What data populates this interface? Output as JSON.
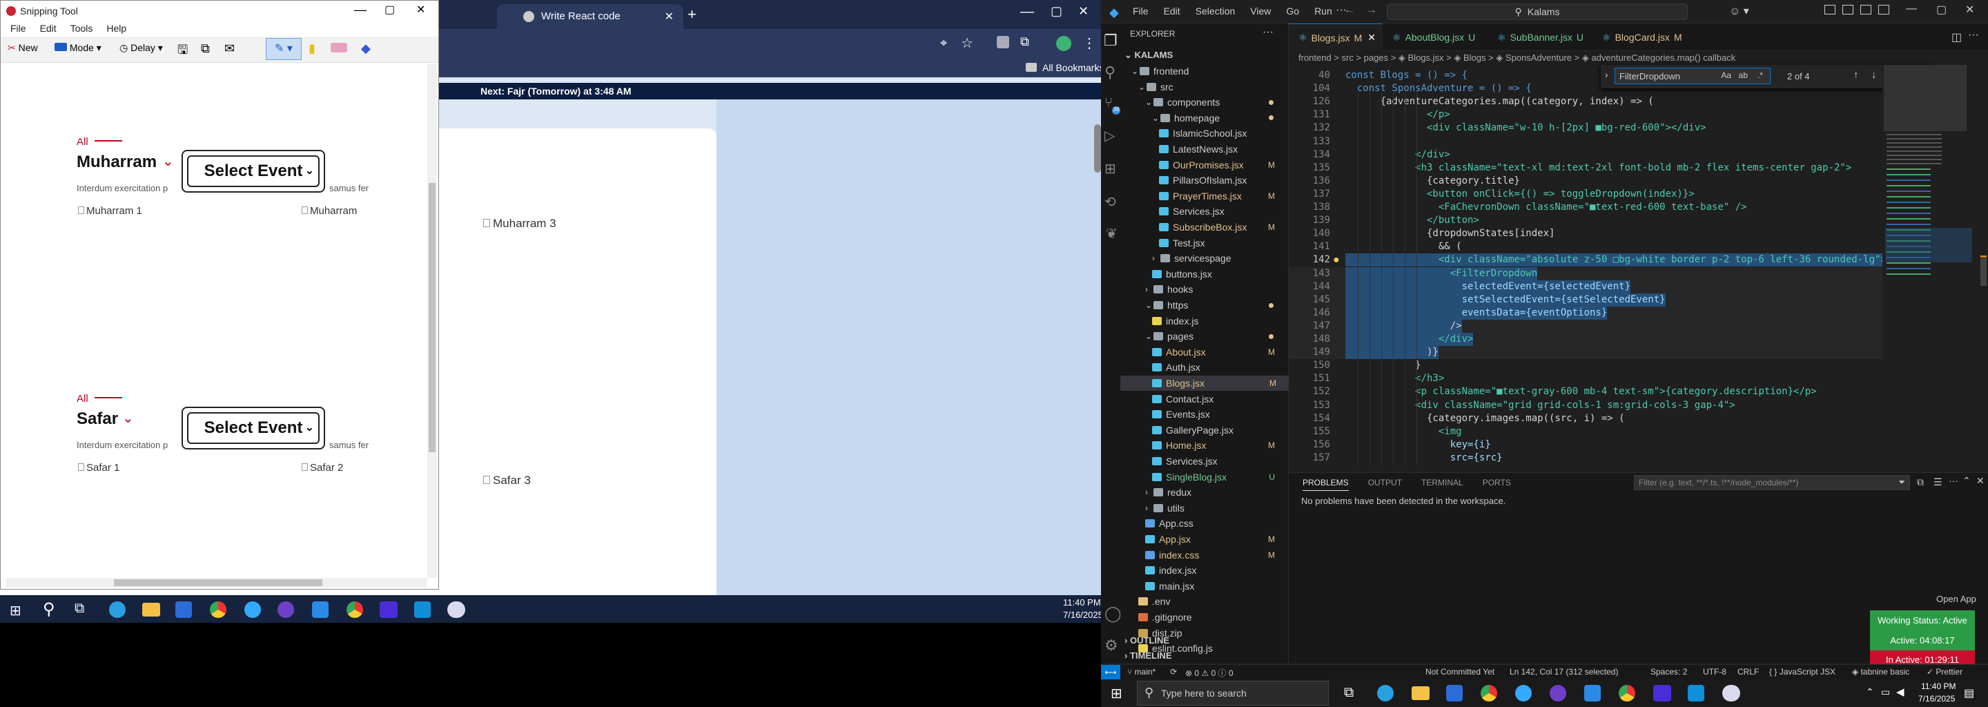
{
  "snip": {
    "title": "Snipping Tool",
    "menu": [
      "File",
      "Edit",
      "Tools",
      "Help"
    ],
    "new_label": "New",
    "mode_label": "Mode",
    "delay_label": "Delay",
    "banner": "Next: Fajr (Tomorrow) at 3:48 AM",
    "sections": [
      {
        "tag": "All",
        "heading": "Muharram",
        "dropdown": "Select Event",
        "intro": "Interdum exercitation p",
        "intro2": "samus fer",
        "img1": "Muharram 1",
        "img2": "Muharram",
        "img3": "Muharram 3"
      },
      {
        "tag": "All",
        "heading": "Safar",
        "dropdown": "Select Event",
        "intro": "Interdum exercitation p",
        "intro2": "samus fer",
        "img1": "Safar 1",
        "img2": "Safar 2",
        "img3": "Safar 3"
      }
    ]
  },
  "chrome": {
    "tab_title": "Write React code",
    "bookmarks": "All Bookmarks"
  },
  "taskbar_left": {
    "time": "11:40 PM",
    "date": "7/16/2025"
  },
  "vscode": {
    "menu": [
      "File",
      "Edit",
      "Selection",
      "View",
      "Go",
      "Run"
    ],
    "search": "Kalams",
    "explorer_title": "EXPLORER",
    "root": "KALAMS",
    "tree": [
      {
        "label": "frontend",
        "depth": 1,
        "kind": "folder",
        "open": true,
        "badge": ""
      },
      {
        "label": "src",
        "depth": 2,
        "kind": "folder",
        "open": true,
        "badge": ""
      },
      {
        "label": "components",
        "depth": 3,
        "kind": "folder",
        "open": true,
        "badge": ""
      },
      {
        "label": "homepage",
        "depth": 4,
        "kind": "folder",
        "open": true,
        "badge": ""
      },
      {
        "label": "IslamicSchool.jsx",
        "depth": 5,
        "kind": "jsx",
        "badge": ""
      },
      {
        "label": "LatestNews.jsx",
        "depth": 5,
        "kind": "jsx",
        "badge": ""
      },
      {
        "label": "OurPromises.jsx",
        "depth": 5,
        "kind": "jsx",
        "badge": "M",
        "mod": true
      },
      {
        "label": "PillarsOfIslam.jsx",
        "depth": 5,
        "kind": "jsx",
        "badge": ""
      },
      {
        "label": "PrayerTimes.jsx",
        "depth": 5,
        "kind": "jsx",
        "badge": "M",
        "mod": true
      },
      {
        "label": "Services.jsx",
        "depth": 5,
        "kind": "jsx",
        "badge": ""
      },
      {
        "label": "SubscribeBox.jsx",
        "depth": 5,
        "kind": "jsx",
        "badge": "M",
        "mod": true
      },
      {
        "label": "Test.jsx",
        "depth": 5,
        "kind": "jsx",
        "badge": ""
      },
      {
        "label": "servicespage",
        "depth": 4,
        "kind": "folder",
        "open": false,
        "badge": ""
      },
      {
        "label": "buttons.jsx",
        "depth": 4,
        "kind": "jsx",
        "badge": ""
      },
      {
        "label": "hooks",
        "depth": 3,
        "kind": "folder",
        "open": false,
        "badge": ""
      },
      {
        "label": "https",
        "depth": 3,
        "kind": "folder",
        "open": true,
        "badge": ""
      },
      {
        "label": "index.js",
        "depth": 4,
        "kind": "js",
        "badge": ""
      },
      {
        "label": "pages",
        "depth": 3,
        "kind": "folder",
        "open": true,
        "badge": ""
      },
      {
        "label": "About.jsx",
        "depth": 4,
        "kind": "jsx",
        "badge": "M",
        "mod": true
      },
      {
        "label": "Auth.jsx",
        "depth": 4,
        "kind": "jsx",
        "badge": ""
      },
      {
        "label": "Blogs.jsx",
        "depth": 4,
        "kind": "jsx",
        "badge": "M",
        "mod": true,
        "active": true
      },
      {
        "label": "Contact.jsx",
        "depth": 4,
        "kind": "jsx",
        "badge": ""
      },
      {
        "label": "Events.jsx",
        "depth": 4,
        "kind": "jsx",
        "badge": ""
      },
      {
        "label": "GalleryPage.jsx",
        "depth": 4,
        "kind": "jsx",
        "badge": ""
      },
      {
        "label": "Home.jsx",
        "depth": 4,
        "kind": "jsx",
        "badge": "M",
        "mod": true
      },
      {
        "label": "Services.jsx",
        "depth": 4,
        "kind": "jsx",
        "badge": ""
      },
      {
        "label": "SingleBlog.jsx",
        "depth": 4,
        "kind": "jsx",
        "badge": "U",
        "untr": true
      },
      {
        "label": "redux",
        "depth": 3,
        "kind": "folder",
        "open": false,
        "badge": ""
      },
      {
        "label": "utils",
        "depth": 3,
        "kind": "folder",
        "open": false,
        "badge": ""
      },
      {
        "label": "App.css",
        "depth": 3,
        "kind": "css",
        "badge": ""
      },
      {
        "label": "App.jsx",
        "depth": 3,
        "kind": "jsx",
        "badge": "M",
        "mod": true
      },
      {
        "label": "index.css",
        "depth": 3,
        "kind": "css",
        "badge": "M",
        "mod": true
      },
      {
        "label": "index.jsx",
        "depth": 3,
        "kind": "jsx",
        "badge": ""
      },
      {
        "label": "main.jsx",
        "depth": 3,
        "kind": "jsx",
        "badge": ""
      },
      {
        "label": ".env",
        "depth": 2,
        "kind": "env",
        "badge": ""
      },
      {
        "label": ".gitignore",
        "depth": 2,
        "kind": "git",
        "badge": ""
      },
      {
        "label": "dist.zip",
        "depth": 2,
        "kind": "zip",
        "badge": ""
      },
      {
        "label": "eslint.config.js",
        "depth": 2,
        "kind": "js",
        "badge": ""
      }
    ],
    "outline": "OUTLINE",
    "timeline": "TIMELINE",
    "tabs": [
      {
        "label": "Blogs.jsx",
        "flag": "M",
        "active": true
      },
      {
        "label": "AboutBlog.jsx",
        "flag": "U"
      },
      {
        "label": "SubBanner.jsx",
        "flag": "U"
      },
      {
        "label": "BlogCard.jsx",
        "flag": "M"
      }
    ],
    "breadcrumb": "frontend > src > pages > ◈ Blogs.jsx > ◈ Blogs > ◈ SponsAdventure > ◈ adventureCategories.map() callback",
    "find": {
      "value": "FilterDropdown",
      "count": "2 of 4"
    },
    "code": [
      {
        "n": "40",
        "t": "const Blogs = () => {"
      },
      {
        "n": "104",
        "t": "  const SponsAdventure = () => {"
      },
      {
        "n": "126",
        "t": "      {adventureCategories.map((category, index) => ("
      },
      {
        "n": "131",
        "t": "              </p>"
      },
      {
        "n": "132",
        "t": "              <div className=\"w-10 h-[2px] ■bg-red-600\"></div>"
      },
      {
        "n": "133",
        "t": ""
      },
      {
        "n": "134",
        "t": "            </div>"
      },
      {
        "n": "135",
        "t": "            <h3 className=\"text-xl md:text-2xl font-bold mb-2 flex items-center gap-2\">"
      },
      {
        "n": "136",
        "t": "              {category.title}"
      },
      {
        "n": "137",
        "t": "              <button onClick={() => toggleDropdown(index)}>"
      },
      {
        "n": "138",
        "t": "                <FaChevronDown className=\"■text-red-600 text-base\" />"
      },
      {
        "n": "139",
        "t": "              </button>"
      },
      {
        "n": "140",
        "t": "              {dropdownStates[index]"
      },
      {
        "n": "141",
        "t": "                && ("
      },
      {
        "n": "142",
        "t": "                <div className=\"absolute z-50 □bg-white border p-2 top-6 left-36 rounded-lg\">"
      },
      {
        "n": "143",
        "t": "                  <FilterDropdown"
      },
      {
        "n": "144",
        "t": "                    selectedEvent={selectedEvent}"
      },
      {
        "n": "145",
        "t": "                    setSelectedEvent={setSelectedEvent}"
      },
      {
        "n": "146",
        "t": "                    eventsData={eventOptions}"
      },
      {
        "n": "147",
        "t": "                  />"
      },
      {
        "n": "148",
        "t": "                </div>"
      },
      {
        "n": "149",
        "t": "              )}"
      },
      {
        "n": "150",
        "t": "            }"
      },
      {
        "n": "151",
        "t": "            </h3>"
      },
      {
        "n": "152",
        "t": "            <p className=\"■text-gray-600 mb-4 text-sm\">{category.description}</p>"
      },
      {
        "n": "153",
        "t": "            <div className=\"grid grid-cols-1 sm:grid-cols-3 gap-4\">"
      },
      {
        "n": "154",
        "t": "              {category.images.map((src, i) => ("
      },
      {
        "n": "155",
        "t": "                <img"
      },
      {
        "n": "156",
        "t": "                  key={i}"
      },
      {
        "n": "157",
        "t": "                  src={src}"
      }
    ],
    "panel_tabs": [
      "PROBLEMS",
      "OUTPUT",
      "TERMINAL",
      "PORTS"
    ],
    "panel_filter": "Filter (e.g. text, **/*.ts, !**/node_modules/**)",
    "panel_message": "No problems have been detected in the workspace.",
    "status": {
      "branch": "main*",
      "errors": "0 ⚠ 0 ⓘ 0",
      "commit": "Not Committed Yet",
      "pos": "Ln 142, Col 17 (312 selected)",
      "spaces": "Spaces: 2",
      "enc": "UTF-8",
      "eol": "CRLF",
      "lang": "JavaScript JSX",
      "ext": "tabnine basic",
      "prettier": "Prettier"
    },
    "wakatime": {
      "open": "Open App",
      "working": "Working Status: Active",
      "active": "Active: 04:08:17",
      "inactive": "In Active: 01:29:11"
    }
  },
  "taskbar": {
    "search": "Type here to search",
    "time": "11:40 PM",
    "date": "7/16/2025"
  },
  "colors": {
    "vs_bg": "#1e1e1e",
    "accent_red": "#c0001c",
    "vs_blue": "#007acc"
  }
}
